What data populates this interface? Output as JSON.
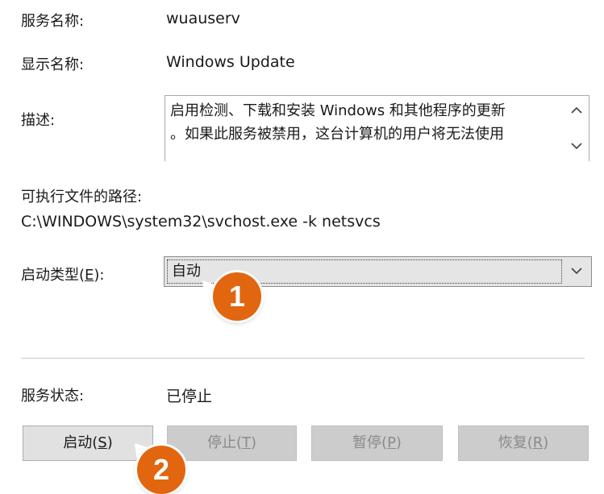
{
  "service": {
    "service_name_label": "服务名称:",
    "service_name_value": "wuauserv",
    "display_name_label": "显示名称:",
    "display_name_value": "Windows Update",
    "description_label": "描述:",
    "description_line1": "启用检测、下载和安装 Windows 和其他程序的更新",
    "description_line2": "。如果此服务被禁用，这台计算机的用户将无法使用",
    "executable_path_label": "可执行文件的路径:",
    "executable_path_value": "C:\\WINDOWS\\system32\\svchost.exe -k netsvcs"
  },
  "startup": {
    "label_text": "启动类型(",
    "label_key": "E",
    "label_end": "):",
    "selected_value": "自动"
  },
  "status": {
    "label": "服务状态:",
    "value": "已停止"
  },
  "buttons": {
    "start": {
      "text": "启动(",
      "key": "S",
      "end": ")"
    },
    "stop": {
      "text": "停止(",
      "key": "T",
      "end": ")"
    },
    "pause": {
      "text": "暂停(",
      "key": "P",
      "end": ")"
    },
    "resume": {
      "text": "恢复(",
      "key": "R",
      "end": ")"
    }
  },
  "annotations": {
    "step1": "1",
    "step2": "2"
  },
  "colors": {
    "badge": "#e2650f",
    "button_bg": "#e1e1e1",
    "button_disabled_bg": "#cccccc"
  }
}
